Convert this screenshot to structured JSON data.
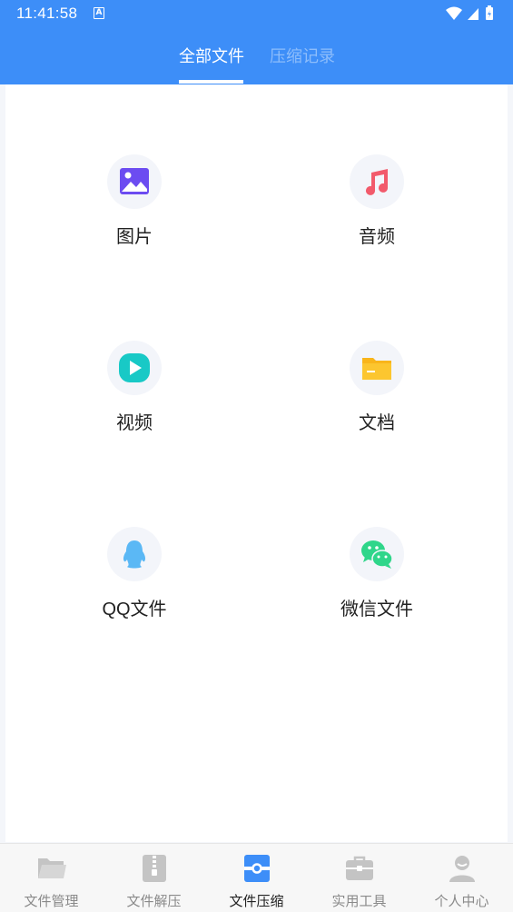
{
  "status_bar": {
    "time": "11:41:58",
    "notification_icon": "A"
  },
  "tabs": [
    {
      "label": "全部文件",
      "active": true
    },
    {
      "label": "压缩记录",
      "active": false
    }
  ],
  "categories": [
    {
      "label": "图片",
      "icon": "image-icon",
      "color": "#6c4cf1"
    },
    {
      "label": "音频",
      "icon": "music-note-icon",
      "color": "#f25a6b"
    },
    {
      "label": "视频",
      "icon": "play-icon",
      "color": "#18c9c6"
    },
    {
      "label": "文档",
      "icon": "folder-icon",
      "color": "#f9b51a"
    },
    {
      "label": "QQ文件",
      "icon": "qq-penguin-icon",
      "color": "#5bb8f5"
    },
    {
      "label": "微信文件",
      "icon": "wechat-icon",
      "color": "#2fd68a"
    }
  ],
  "bottom_nav": [
    {
      "label": "文件管理",
      "icon": "folder-open-icon",
      "active": false
    },
    {
      "label": "文件解压",
      "icon": "zip-file-icon",
      "active": false
    },
    {
      "label": "文件压缩",
      "icon": "compress-icon",
      "active": true
    },
    {
      "label": "实用工具",
      "icon": "toolbox-icon",
      "active": false
    },
    {
      "label": "个人中心",
      "icon": "user-icon",
      "active": false
    }
  ],
  "colors": {
    "header": "#3d8ef8",
    "nav_active": "#3d8ef8",
    "nav_inactive": "#c4c4c4"
  }
}
